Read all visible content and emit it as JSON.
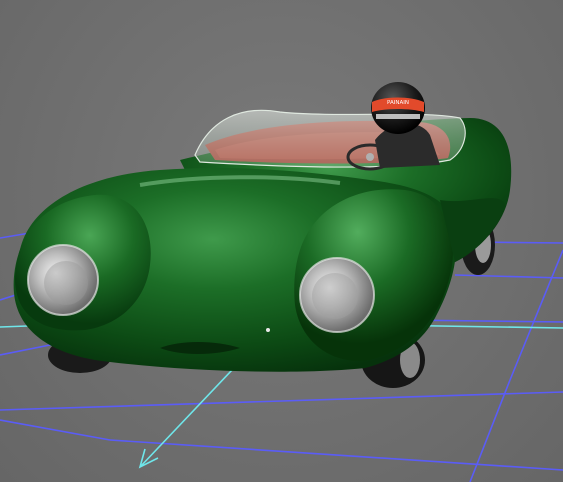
{
  "viewport": {
    "background_color": "#6f6f6f",
    "grid_color": "#5a5cff",
    "axis_color": "#6fe6ea"
  },
  "model": {
    "body_color": "#0f5a1a",
    "interior_color": "#b84a3d",
    "headlight_color": "#c9c9c9",
    "helmet_color": "#1a1a1a",
    "helmet_stripe_color": "#e24a2b",
    "helmet_text": "PAINAIN"
  }
}
